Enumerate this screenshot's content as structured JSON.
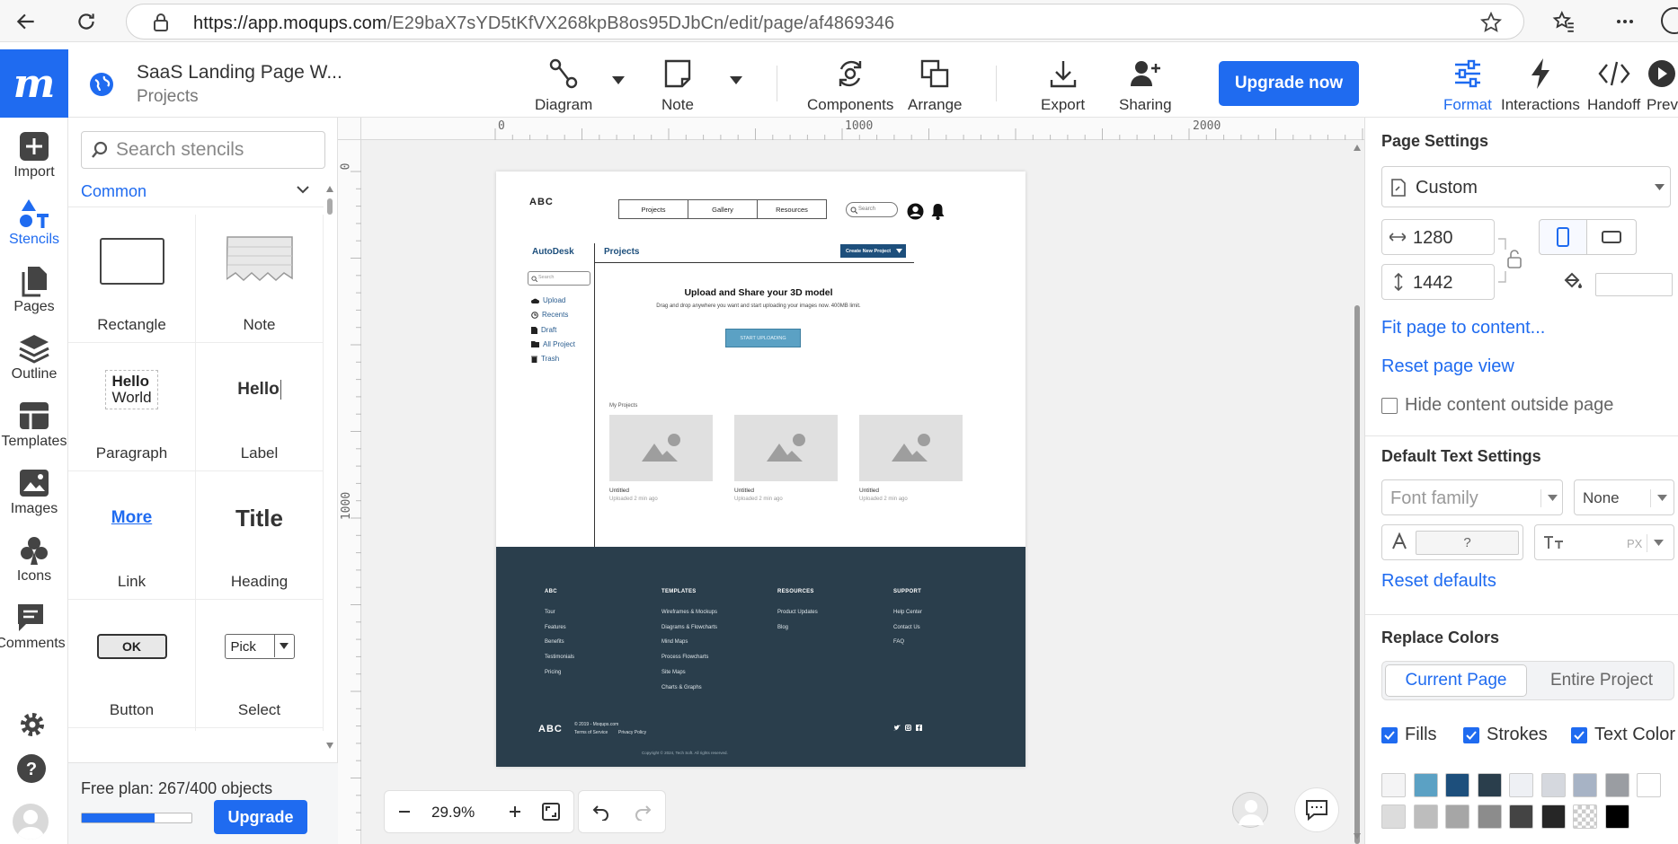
{
  "browser": {
    "url_domain": "https://app.moqups.com",
    "url_path": "/E29baX7sYD5tKfVX268kpB8os95DJbCn/edit/page/af4869346"
  },
  "header": {
    "logo": "m",
    "doc_title": "SaaS Landing Page W...",
    "doc_subtitle": "Projects",
    "tools": {
      "diagram": "Diagram",
      "note": "Note",
      "components": "Components",
      "arrange": "Arrange",
      "export": "Export",
      "sharing": "Sharing",
      "upgrade": "Upgrade now",
      "format": "Format",
      "interactions": "Interactions",
      "handoff": "Handoff",
      "preview": "Previ"
    }
  },
  "rail": {
    "import": "Import",
    "stencils": "Stencils",
    "pages": "Pages",
    "outline": "Outline",
    "templates": "Templates",
    "images": "Images",
    "icons": "Icons",
    "comments": "Comments"
  },
  "stencils": {
    "search_placeholder": "Search stencils",
    "category": "Common",
    "items": {
      "rectangle": "Rectangle",
      "note": "Note",
      "paragraph": "Paragraph",
      "paragraph_preview_1": "Hello",
      "paragraph_preview_2": "World",
      "label": "Label",
      "label_preview": "Hello",
      "link": "Link",
      "link_preview": "More",
      "heading": "Heading",
      "heading_preview": "Title",
      "button": "Button",
      "button_preview": "OK",
      "select": "Select",
      "select_preview": "Pick"
    },
    "plan_text": "Free plan: 267/400 objects",
    "plan_used": 267,
    "plan_total": 400,
    "upgrade": "Upgrade"
  },
  "canvas": {
    "ruler_h": [
      "0",
      "1000",
      "2000"
    ],
    "ruler_v": [
      "0",
      "1000"
    ],
    "zoom": "29.9%"
  },
  "mockup": {
    "logo": "ABC",
    "nav": [
      "Projects",
      "Gallery",
      "Resources"
    ],
    "search": "Search",
    "side_title": "AutoDesk",
    "side_search": "Search",
    "side_items": [
      "Upload",
      "Recents",
      "Draft",
      "All Project",
      "Trash"
    ],
    "main_title": "Projects",
    "create_btn": "Create New Project",
    "hero_title": "Upload and Share your 3D model",
    "hero_sub": "Drag and drop anywhere you want and start uploading your images now. 400MB limit.",
    "hero_btn": "START UPLOADING",
    "my_projects": "My Projects",
    "card_name": "Untitled",
    "card_date": "Uploaded 2 min ago",
    "footer": {
      "col1_title": "ABC",
      "col1": [
        "Tour",
        "Features",
        "Benefits",
        "Testimonials",
        "Pricing"
      ],
      "col2_title": "TEMPLATES",
      "col2": [
        "Wireframes & Mockups",
        "Diagrams & Flowcharts",
        "Mind Maps",
        "Process Flowcharts",
        "Site Maps",
        "Charts & Graphs"
      ],
      "col3_title": "RESOURCES",
      "col3": [
        "Product Updates",
        "Blog"
      ],
      "col4_title": "SUPPORT",
      "col4": [
        "Help Center",
        "Contact Us",
        "FAQ"
      ],
      "logo": "ABC",
      "copyright": "© 2019 - Moqups.com",
      "terms": "Terms of Service",
      "privacy": "Privacy Policy",
      "bottom": "Copyright © 2024, Tech Soft. All rights reserved."
    }
  },
  "panel": {
    "page_settings": "Page Settings",
    "preset": "Custom",
    "width": "1280",
    "height": "1442",
    "fit_page": "Fit page to content...",
    "reset_view": "Reset page view",
    "hide_outside": "Hide content outside page",
    "text_settings": "Default Text Settings",
    "font_family": "Font family",
    "font_style": "None",
    "font_size_placeholder": "?",
    "px": "PX",
    "reset_defaults": "Reset defaults",
    "replace_colors": "Replace Colors",
    "tab_current": "Current Page",
    "tab_entire": "Entire Project",
    "chk_fills": "Fills",
    "chk_strokes": "Strokes",
    "chk_text": "Text Color",
    "swatches_row1": [
      "#f4f4f5",
      "#5ba1c4",
      "#1d4f7c",
      "#2a3e4c",
      "#eef0f4",
      "#d5d8de",
      "#a7b3c5",
      "#9a9da2",
      "#ffffff"
    ],
    "swatches_row2": [
      "#dcdcdc",
      "#bdbdbd",
      "#a6a6a6",
      "#8c8c8c",
      "#444444",
      "#262626",
      "checker",
      "#000000"
    ]
  }
}
